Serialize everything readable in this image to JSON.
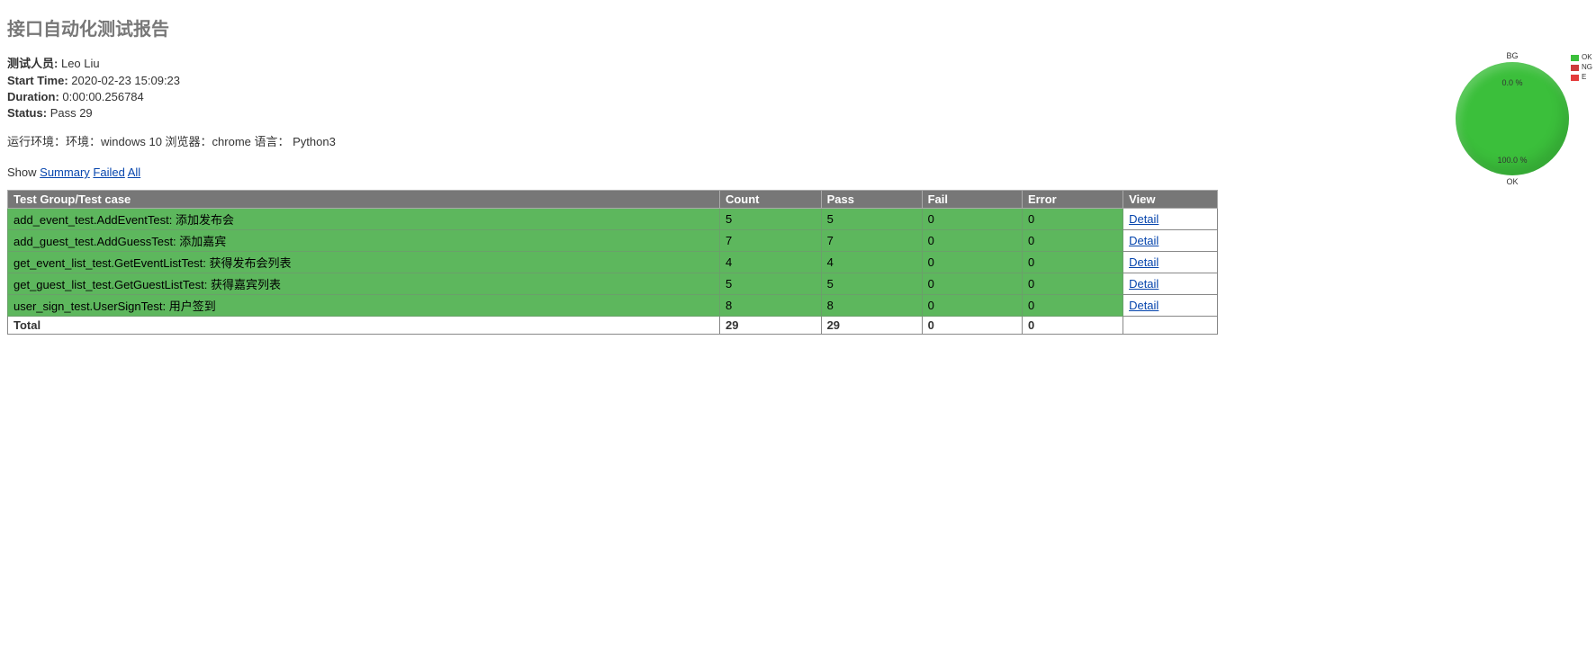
{
  "title": "接口自动化测试报告",
  "meta": {
    "tester_label": "测试人员:",
    "tester_value": "Leo Liu",
    "start_label": "Start Time:",
    "start_value": "2020-02-23 15:09:23",
    "duration_label": "Duration:",
    "duration_value": "0:00:00.256784",
    "status_label": "Status:",
    "status_value": "Pass 29"
  },
  "env": "运行环境：环境：windows 10 浏览器：chrome 语言： Python3",
  "filters": {
    "show_label": "Show",
    "summary": "Summary",
    "failed": "Failed",
    "all": "All"
  },
  "chart_data": {
    "type": "pie",
    "title_top": "BG",
    "title_bottom": "OK",
    "slices": [
      {
        "name": "OK",
        "percent": 100.0,
        "color": "#3bbf3b"
      },
      {
        "name": "NG",
        "percent": 0.0,
        "color": "#cc3b3b"
      },
      {
        "name": "E",
        "percent": 0.0,
        "color": "#e43b3b"
      }
    ],
    "inside_top": "0.0 %",
    "inside_bottom": "100.0 %",
    "legend": [
      "OK",
      "NG",
      "E"
    ]
  },
  "table": {
    "headers": {
      "name": "Test Group/Test case",
      "count": "Count",
      "pass": "Pass",
      "fail": "Fail",
      "error": "Error",
      "view": "View"
    },
    "view_link_label": "Detail",
    "rows": [
      {
        "name": "add_event_test.AddEventTest: 添加发布会",
        "count": 5,
        "pass": 5,
        "fail": 0,
        "error": 0
      },
      {
        "name": "add_guest_test.AddGuessTest: 添加嘉宾",
        "count": 7,
        "pass": 7,
        "fail": 0,
        "error": 0
      },
      {
        "name": "get_event_list_test.GetEventListTest: 获得发布会列表",
        "count": 4,
        "pass": 4,
        "fail": 0,
        "error": 0
      },
      {
        "name": "get_guest_list_test.GetGuestListTest: 获得嘉宾列表",
        "count": 5,
        "pass": 5,
        "fail": 0,
        "error": 0
      },
      {
        "name": "user_sign_test.UserSignTest: 用户签到",
        "count": 8,
        "pass": 8,
        "fail": 0,
        "error": 0
      }
    ],
    "total": {
      "label": "Total",
      "count": 29,
      "pass": 29,
      "fail": 0,
      "error": 0
    }
  }
}
